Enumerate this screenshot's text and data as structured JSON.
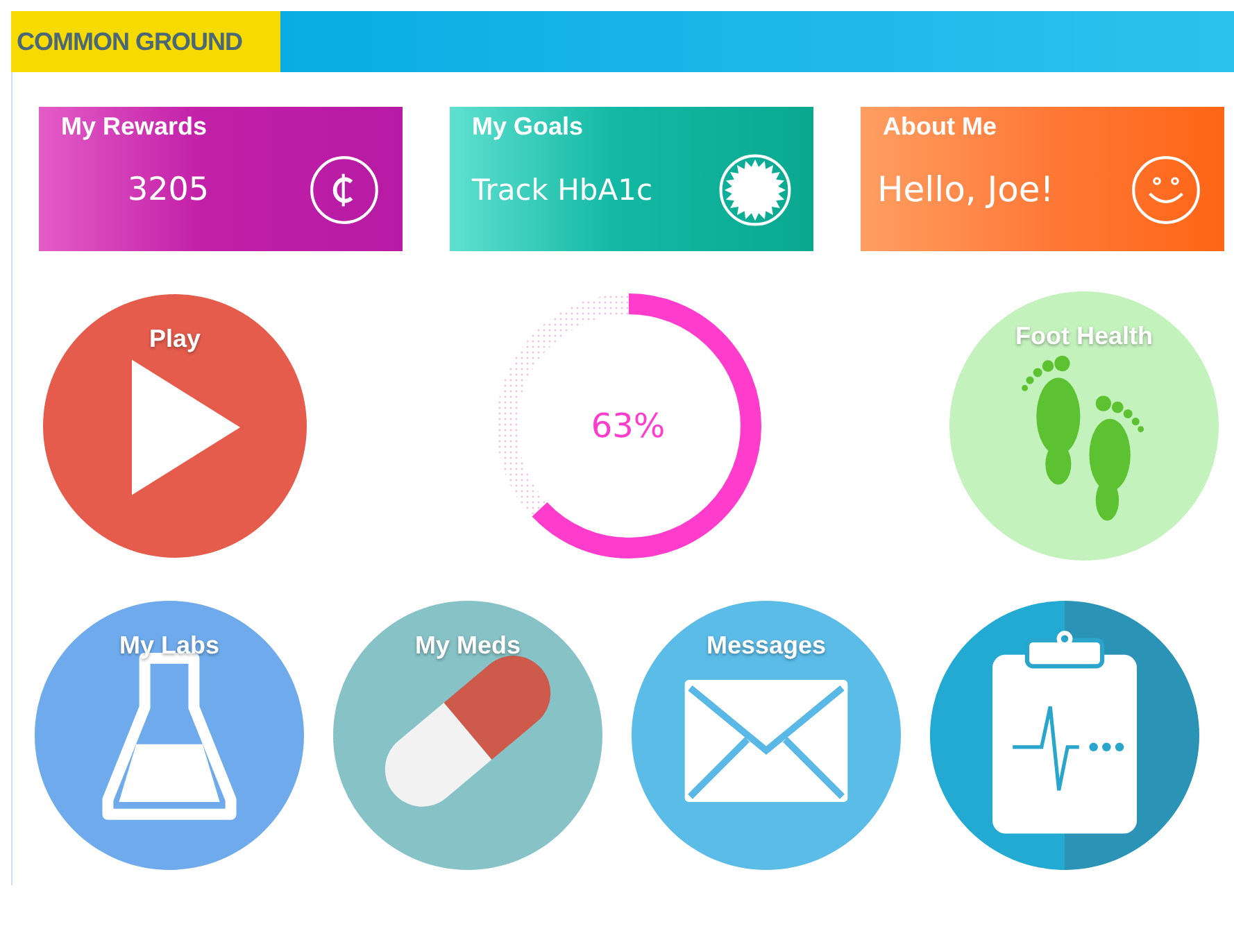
{
  "header": {
    "logo": "COMMON GROUND"
  },
  "cards": [
    {
      "kind": "rewards",
      "title": "My Rewards",
      "value": "3205"
    },
    {
      "kind": "goals",
      "title": "My Goals",
      "value": "Track HbA1c"
    },
    {
      "kind": "about",
      "title": "About Me",
      "value": "Hello, Joe!"
    }
  ],
  "middle_tiles": [
    {
      "kind": "play",
      "label": "Play"
    },
    {
      "kind": "progress",
      "label": "63%",
      "level": 0.63
    },
    {
      "kind": "foot",
      "label": "Foot Health"
    }
  ],
  "bottom_tiles": [
    {
      "kind": "labs",
      "label": "My Labs"
    },
    {
      "kind": "meds",
      "label": "My Meds"
    },
    {
      "kind": "messages",
      "label": "Messages"
    },
    {
      "kind": "clipboard"
    }
  ]
}
